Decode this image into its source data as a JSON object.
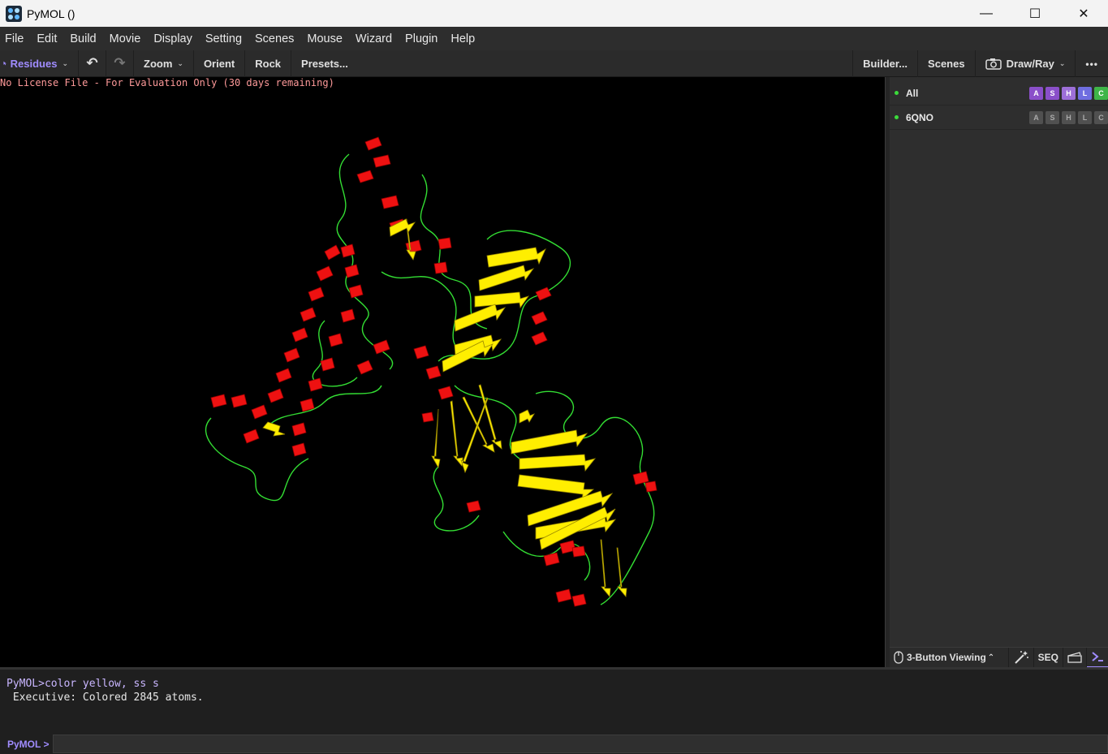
{
  "window": {
    "title": "PyMOL ()",
    "controls": {
      "minimize": "—",
      "maximize": "☐",
      "close": "✕"
    }
  },
  "menu": [
    "File",
    "Edit",
    "Build",
    "Movie",
    "Display",
    "Setting",
    "Scenes",
    "Mouse",
    "Wizard",
    "Plugin",
    "Help"
  ],
  "toolbar": {
    "mode_label": "Residues",
    "undo": "↶",
    "redo": "↷",
    "zoom": "Zoom",
    "orient": "Orient",
    "rock": "Rock",
    "presets": "Presets...",
    "builder": "Builder...",
    "scenes": "Scenes",
    "draw_ray": "Draw/Ray",
    "more": "•••"
  },
  "viewport": {
    "license_text": "No License File - For Evaluation Only (30 days remaining)",
    "colors": {
      "helix": "#ff0000",
      "sheet": "#ffff00",
      "loop": "#33dd33"
    }
  },
  "objects": [
    {
      "name": "All",
      "buttons": [
        "A",
        "S",
        "H",
        "L",
        "C"
      ]
    },
    {
      "name": "6QNO",
      "buttons": [
        "A",
        "S",
        "H",
        "L",
        "C"
      ]
    }
  ],
  "bottom_controls": {
    "viewing_mode": "3-Button Viewing",
    "caret": "⌃",
    "seq": "SEQ"
  },
  "console": {
    "command": "PyMOL>color yellow, ss s",
    "output": " Executive: Colored 2845 atoms.",
    "prompt": "PyMOL >",
    "input_value": ""
  }
}
